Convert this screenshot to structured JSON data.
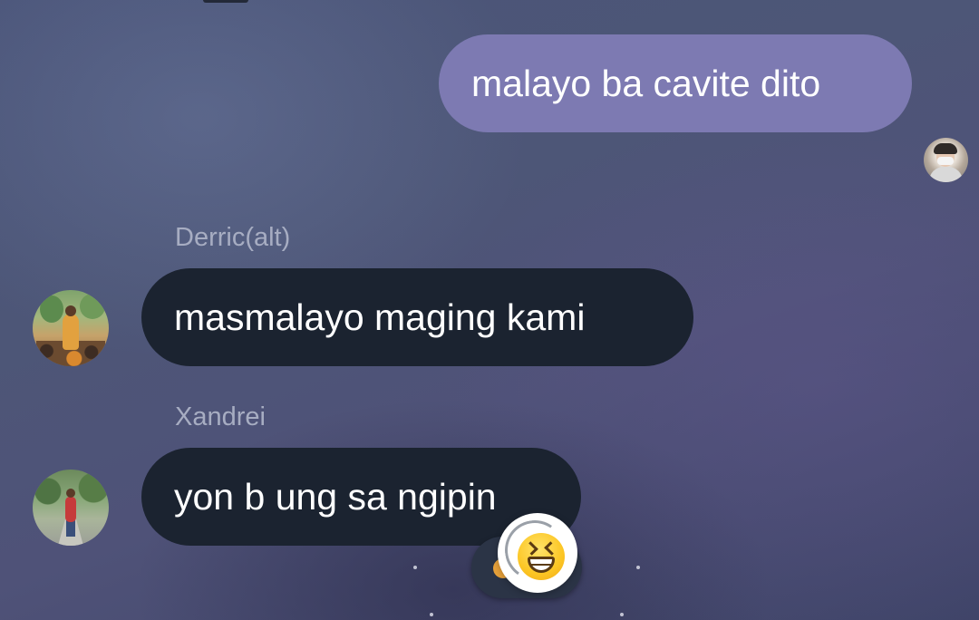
{
  "messages": [
    {
      "direction": "outgoing",
      "text": "malayo ba cavite dito"
    },
    {
      "direction": "incoming",
      "sender": "Derric(alt)",
      "text": "masmalayo maging kami"
    },
    {
      "direction": "incoming",
      "sender": "Xandrei",
      "text": "yon b ung sa ngipin",
      "reaction": "grinning-squinting-face-emoji"
    }
  ],
  "colors": {
    "outgoing_bubble": "#7d7ab2",
    "incoming_bubble": "#1b2330",
    "sender_name": "#a7adc2",
    "bubble_text": "#ffffff"
  }
}
